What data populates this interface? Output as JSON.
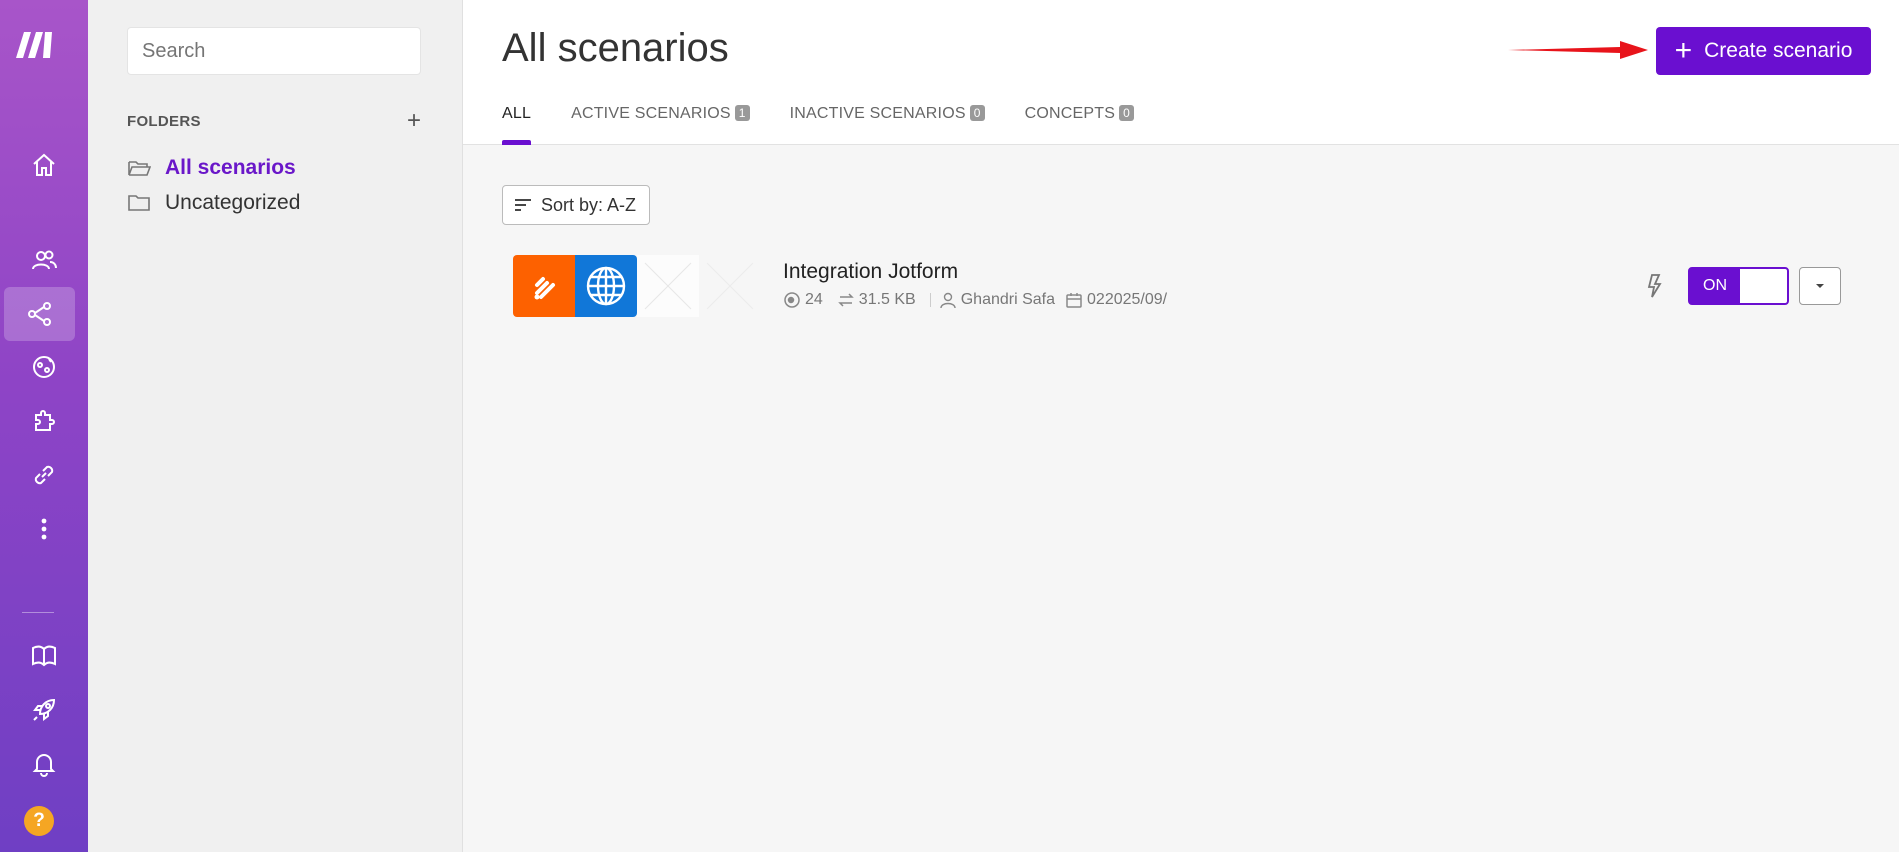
{
  "rail": {
    "items": [
      "logo-icon",
      "home-icon",
      "team-icon",
      "scenarios-icon",
      "templates-icon",
      "apps-icon",
      "connections-icon",
      "more-icon",
      "docs-icon",
      "launch-icon",
      "notifications-icon",
      "help-icon"
    ],
    "help_label": "?"
  },
  "sidebar": {
    "search_placeholder": "Search",
    "folders_label": "FOLDERS",
    "add_label": "+",
    "items": [
      {
        "label": "All scenarios",
        "selected": true
      },
      {
        "label": "Uncategorized",
        "selected": false
      }
    ]
  },
  "header": {
    "title": "All scenarios",
    "create_label": "Create scenario",
    "create_plus": "+"
  },
  "tabs": [
    {
      "label": "ALL",
      "badge": ""
    },
    {
      "label": "ACTIVE SCENARIOS",
      "badge": "1"
    },
    {
      "label": "INACTIVE SCENARIOS",
      "badge": "0"
    },
    {
      "label": "CONCEPTS",
      "badge": "0"
    }
  ],
  "sort": {
    "label": "Sort by: A-Z"
  },
  "scenario": {
    "name": "Integration Jotform",
    "operations": "24",
    "data_size": "31.5 KB",
    "owner": "Ghandri Safa",
    "date": "022025/09/",
    "toggle_label": "ON",
    "status": "on"
  },
  "colors": {
    "accent": "#6a0fd0",
    "rail_top": "#a855c9",
    "rail_bottom": "#6f3fc4",
    "jotform": "#fd6100",
    "http": "#1177d8",
    "arrow": "#e8141b"
  }
}
